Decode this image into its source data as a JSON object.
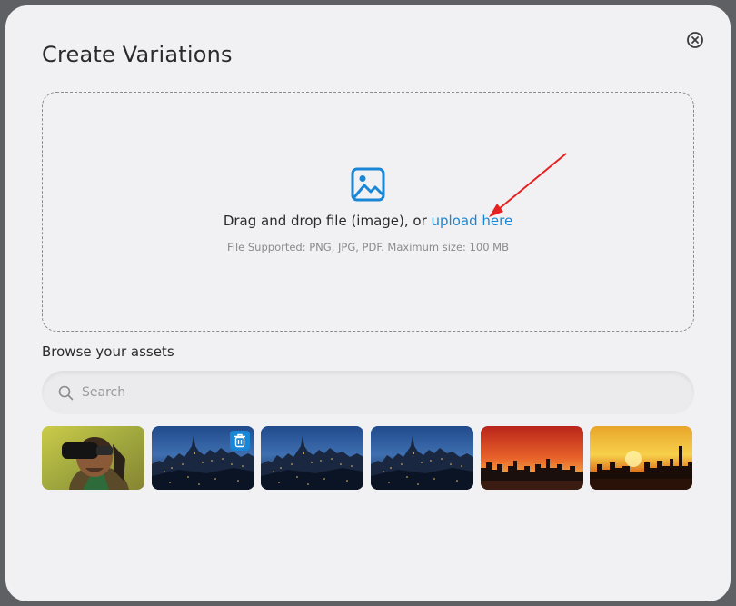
{
  "modal": {
    "title": "Create Variations",
    "close_icon": "close-circle-icon"
  },
  "dropzone": {
    "icon": "image-icon",
    "text_prefix": "Drag and drop file (image), or ",
    "link_text": "upload here",
    "supported_text": "File Supported: PNG, JPG, PDF. Maximum size: 100 MB",
    "annotation": "red-arrow"
  },
  "assets": {
    "section_title": "Browse your assets",
    "search_placeholder": "Search",
    "search_icon": "search-icon",
    "thumbnails": [
      {
        "subject": "man-with-vr-headset",
        "delete_icon": false
      },
      {
        "subject": "city-skyline-night",
        "delete_icon": true
      },
      {
        "subject": "city-skyline-night",
        "delete_icon": false
      },
      {
        "subject": "city-skyline-night",
        "delete_icon": false
      },
      {
        "subject": "city-skyline-sunset-orange",
        "delete_icon": false
      },
      {
        "subject": "city-skyline-sunset-yellow",
        "delete_icon": false
      }
    ]
  },
  "colors": {
    "accent": "#1a86d6",
    "annotation_arrow": "#e52222",
    "modal_bg": "#f1f1f3",
    "overlay": "#5f6063"
  }
}
